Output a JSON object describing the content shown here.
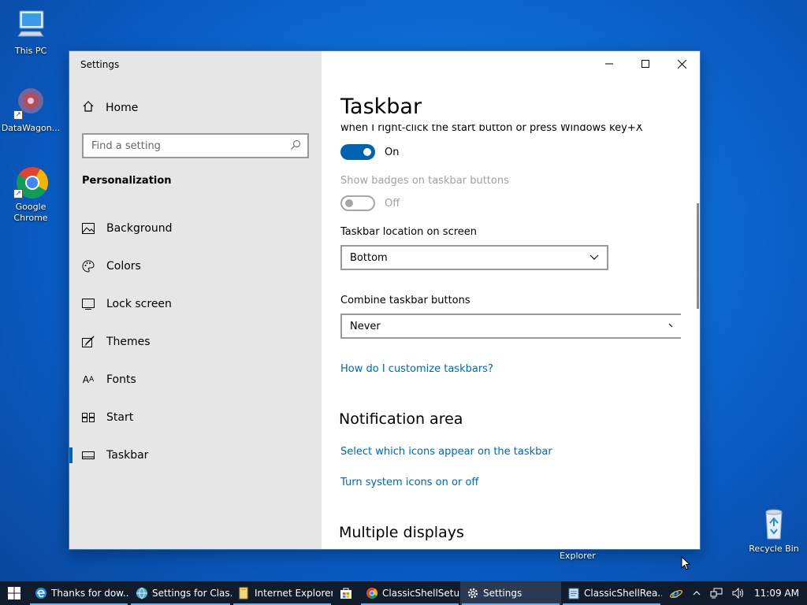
{
  "desktop": {
    "icons": [
      {
        "label": "This PC"
      },
      {
        "label": "DataWagon..."
      },
      {
        "label": "Google Chrome"
      },
      {
        "label": "Recycle Bin"
      }
    ],
    "explorer_label": "Explorer"
  },
  "window": {
    "title": "Settings",
    "sidebar": {
      "home_label": "Home",
      "search_placeholder": "Find a setting",
      "section": "Personalization",
      "items": [
        {
          "label": "Background",
          "icon": "picture-icon"
        },
        {
          "label": "Colors",
          "icon": "palette-icon"
        },
        {
          "label": "Lock screen",
          "icon": "lock-screen-icon"
        },
        {
          "label": "Themes",
          "icon": "brush-icon"
        },
        {
          "label": "Fonts",
          "icon": "font-icon"
        },
        {
          "label": "Start",
          "icon": "start-icon"
        },
        {
          "label": "Taskbar",
          "icon": "taskbar-icon",
          "active": true
        }
      ]
    },
    "content": {
      "page_title": "Taskbar",
      "clipped_text": "when I right-click the start button or press Windows key+X",
      "peek_toggle_state": "On",
      "badges_label": "Show badges on taskbar buttons",
      "badges_toggle_state": "Off",
      "location_label": "Taskbar location on screen",
      "location_value": "Bottom",
      "combine_label": "Combine taskbar buttons",
      "combine_value": "Never",
      "customize_link": "How do I customize taskbars?",
      "notification_heading": "Notification area",
      "select_icons_link": "Select which icons appear on the taskbar",
      "system_icons_link": "Turn system icons on or off",
      "multiple_displays_heading": "Multiple displays"
    }
  },
  "taskbar": {
    "items": [
      {
        "label": "Thanks for dow...",
        "icon": "edge-icon"
      },
      {
        "label": "Settings for Clas...",
        "icon": "globe-icon"
      },
      {
        "label": "Internet Explorer",
        "icon": "folder-icon"
      },
      {
        "label": "",
        "icon": "store-icon"
      },
      {
        "label": "ClassicShellSetu...",
        "icon": "chrome-icon"
      },
      {
        "label": "Settings",
        "icon": "gear-icon",
        "active": true
      },
      {
        "label": "ClassicShellRea...",
        "icon": "notepad-icon"
      }
    ],
    "clock": "11:09 AM"
  },
  "colors": {
    "accent": "#0063b1",
    "link": "#0066b4",
    "taskbar": "#101b2b"
  }
}
